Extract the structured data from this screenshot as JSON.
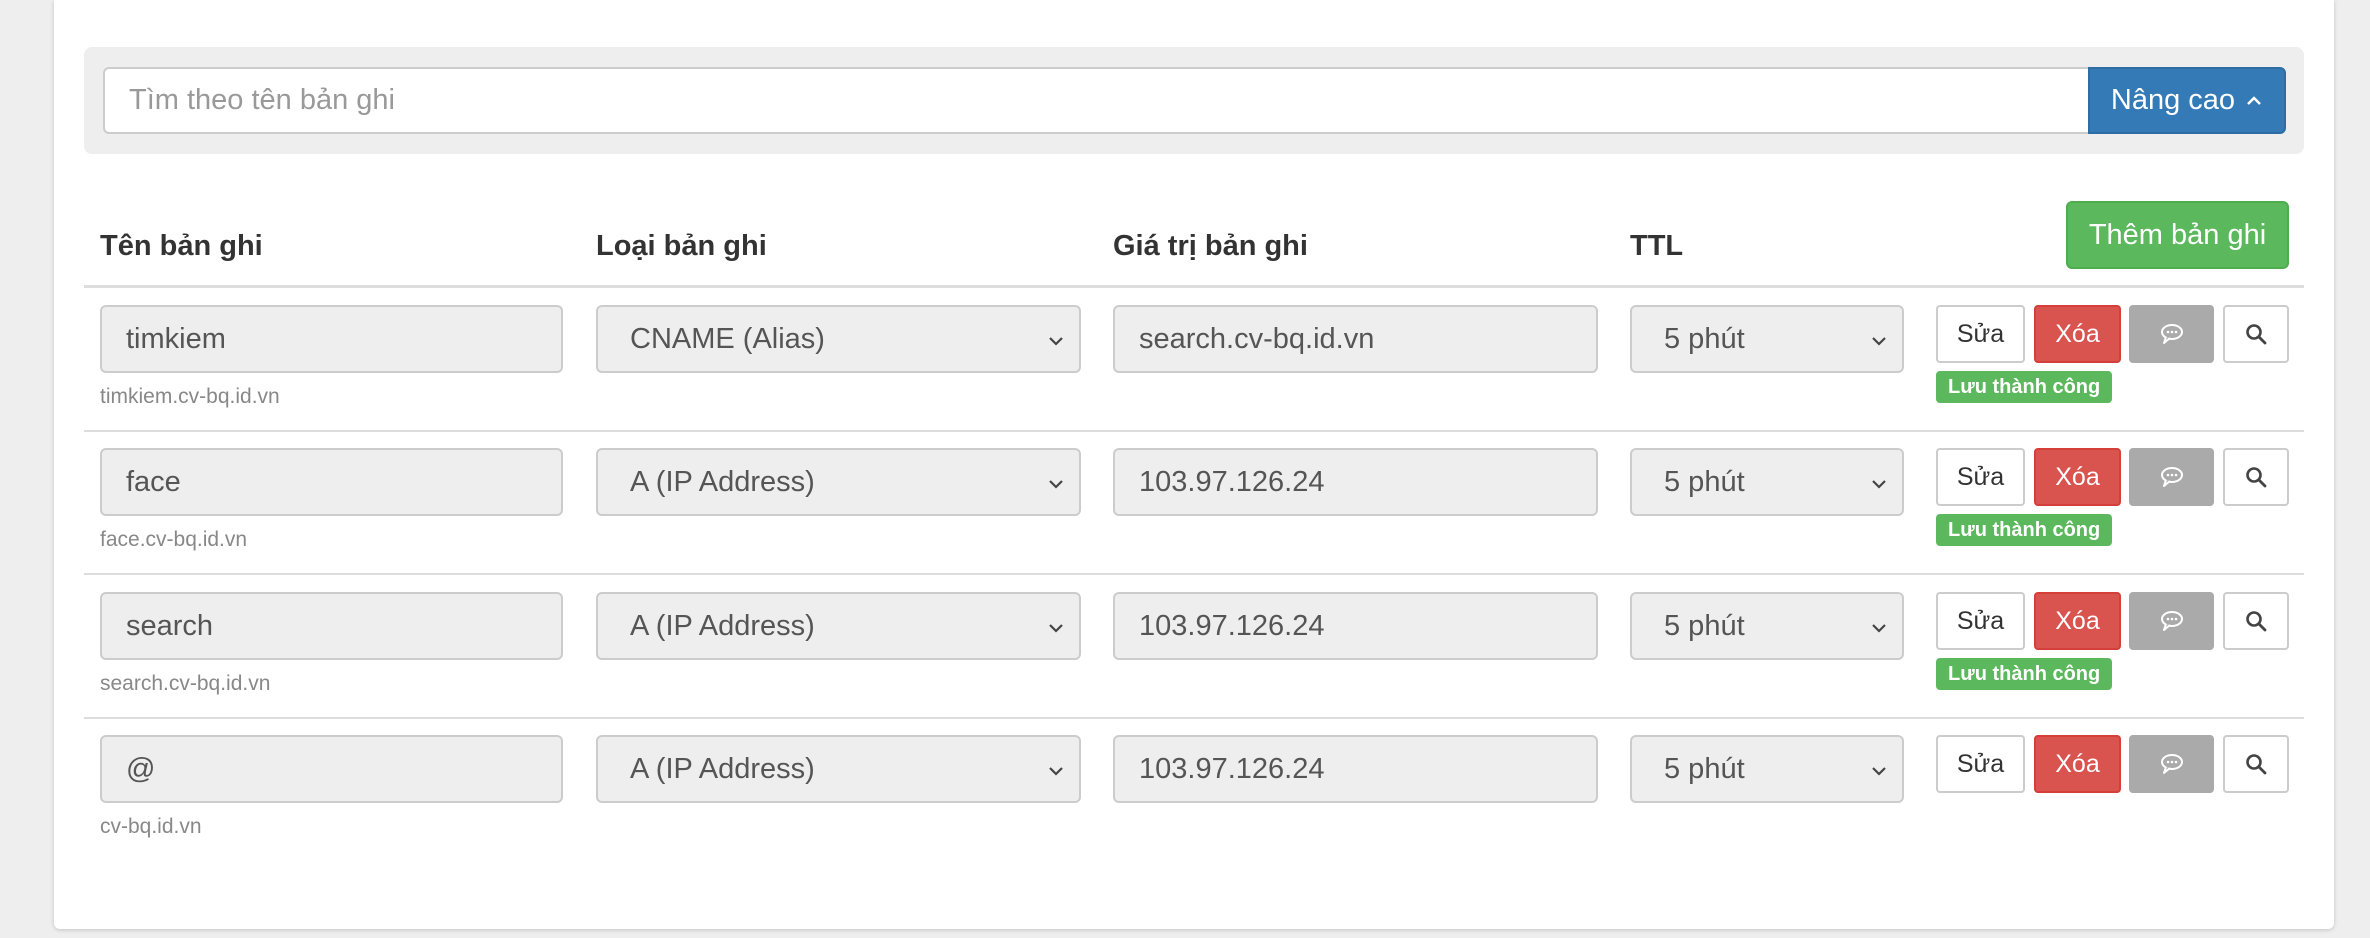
{
  "search": {
    "placeholder": "Tìm theo tên bản ghi",
    "advanced_label": "Nâng cao"
  },
  "table": {
    "headers": {
      "name": "Tên bản ghi",
      "type": "Loại bản ghi",
      "value": "Giá trị bản ghi",
      "ttl": "TTL"
    },
    "add_label": "Thêm bản ghi",
    "edit_label": "Sửa",
    "delete_label": "Xóa",
    "rows": [
      {
        "name": "timkiem",
        "fqdn": "timkiem.cv-bq.id.vn",
        "type": "CNAME (Alias)",
        "value": "search.cv-bq.id.vn",
        "ttl": "5 phút",
        "status": "Lưu thành công"
      },
      {
        "name": "face",
        "fqdn": "face.cv-bq.id.vn",
        "type": "A (IP Address)",
        "value": "103.97.126.24",
        "ttl": "5 phút",
        "status": "Lưu thành công"
      },
      {
        "name": "search",
        "fqdn": "search.cv-bq.id.vn",
        "type": "A (IP Address)",
        "value": "103.97.126.24",
        "ttl": "5 phút",
        "status": "Lưu thành công"
      },
      {
        "name": "@",
        "fqdn": "cv-bq.id.vn",
        "type": "A (IP Address)",
        "value": "103.97.126.24",
        "ttl": "5 phút",
        "status": ""
      }
    ]
  },
  "colors": {
    "primary": "#337ab7",
    "success": "#5cb85c",
    "danger": "#d9534f",
    "muted_button": "#aaaaaa"
  },
  "icons": {
    "advanced_toggle": "chevron-up-icon",
    "comment": "comment-icon",
    "view": "search-icon",
    "select_caret": "chevron-down-icon"
  }
}
